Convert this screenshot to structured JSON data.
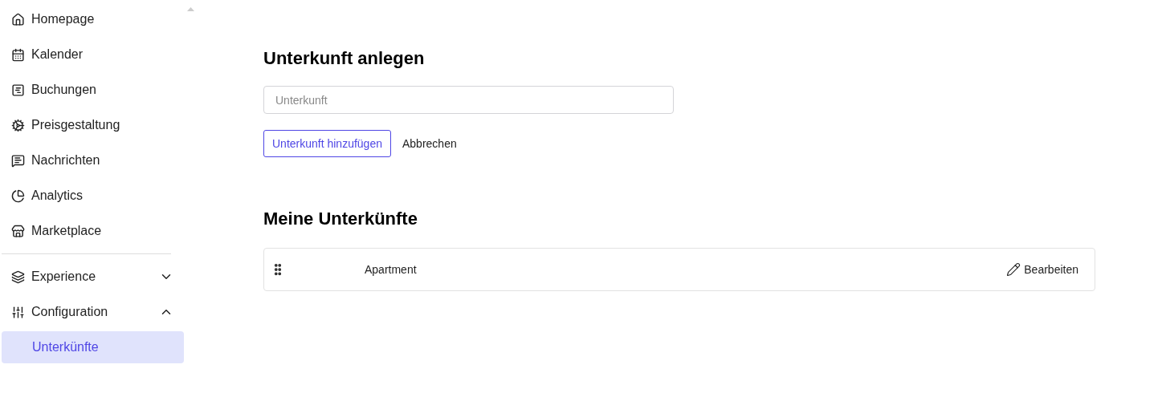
{
  "sidebar": {
    "items": [
      {
        "kind": "link",
        "label": "Homepage"
      },
      {
        "kind": "link",
        "label": "Kalender"
      },
      {
        "kind": "link",
        "label": "Buchungen"
      },
      {
        "kind": "link",
        "label": "Preisgestaltung"
      },
      {
        "kind": "link",
        "label": "Nachrichten"
      },
      {
        "kind": "link",
        "label": "Analytics"
      },
      {
        "kind": "link",
        "label": "Marketplace"
      },
      {
        "kind": "group",
        "label": "Experience",
        "expanded": false
      },
      {
        "kind": "group",
        "label": "Configuration",
        "expanded": true,
        "children": [
          {
            "label": "Unterkünfte",
            "selected": true
          }
        ]
      }
    ]
  },
  "create": {
    "title": "Unterkunft anlegen",
    "field": {
      "placeholder": "Unterkunft"
    },
    "submit": "Unterkunft hinzufügen",
    "cancel": "Abbrechen"
  },
  "list": {
    "title": "Meine Unterkünfte",
    "rows": [
      {
        "name": "Apartment",
        "action": "Bearbeiten"
      }
    ]
  }
}
